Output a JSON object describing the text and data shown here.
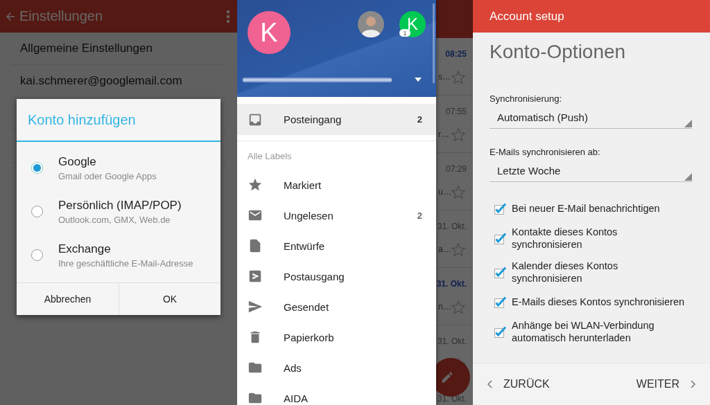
{
  "settings_screen": {
    "title": "Einstellungen",
    "items": [
      "Allgemeine Einstellungen",
      "kai.schmerer@googlemail.com"
    ]
  },
  "add_account_dialog": {
    "title": "Konto hinzufügen",
    "options": [
      {
        "label": "Google",
        "description": "Gmail oder Google Apps",
        "selected": true
      },
      {
        "label": "Persönlich (IMAP/POP)",
        "description": "Outlook.com, GMX, Web.de",
        "selected": false
      },
      {
        "label": "Exchange",
        "description": "Ihre geschäftliche E-Mail-Adresse",
        "selected": false
      }
    ],
    "buttons": [
      "Abbrechen",
      "OK"
    ]
  },
  "mail_list": {
    "rows": [
      {
        "time": "08:25",
        "snippet": "s…",
        "unread": true
      },
      {
        "time": "07:55",
        "snippet": "r…",
        "unread": false
      },
      {
        "time": "07:29",
        "snippet": "u…",
        "unread": false
      },
      {
        "time": "31. Okt.",
        "snippet": "a…",
        "unread": false
      },
      {
        "time": "31. Okt.",
        "snippet": "n…",
        "unread": true
      },
      {
        "time": "31. Okt.",
        "unread": false
      },
      {
        "time": "31. Okt.",
        "unread": false
      }
    ]
  },
  "drawer": {
    "account_initial": "K",
    "other_account_initial": "K",
    "other_account_badge": "1",
    "primary": [
      {
        "kind": "inbox",
        "label": "Posteingang",
        "count": "2",
        "selected": true
      }
    ],
    "section_title": "Alle Labels",
    "labels": [
      {
        "kind": "star",
        "label": "Markiert",
        "selected": false
      },
      {
        "kind": "mail",
        "label": "Ungelesen",
        "count": "2",
        "selected": false
      },
      {
        "kind": "draft",
        "label": "Entwürfe",
        "selected": false
      },
      {
        "kind": "outbox",
        "label": "Postausgang",
        "selected": false
      },
      {
        "kind": "send",
        "label": "Gesendet",
        "selected": false
      },
      {
        "kind": "trash",
        "label": "Papierkorb",
        "selected": false
      },
      {
        "kind": "folder",
        "label": "Ads",
        "selected": false
      },
      {
        "kind": "folder",
        "label": "AIDA",
        "selected": false
      }
    ]
  },
  "account_setup": {
    "title": "Account setup",
    "heading": "Konto-Optionen",
    "fields": [
      {
        "label": "Synchronisierung:",
        "value": "Automatisch (Push)"
      },
      {
        "label": "E-Mails synchronisieren ab:",
        "value": "Letzte Woche"
      }
    ],
    "checkboxes": [
      {
        "label": "Bei neuer E-Mail benachrichtigen",
        "checked": true
      },
      {
        "label": "Kontakte dieses Kontos synchronisieren",
        "checked": true
      },
      {
        "label": "Kalender dieses Kontos synchronisieren",
        "checked": true
      },
      {
        "label": "E-Mails dieses Kontos synchronisieren",
        "checked": true
      },
      {
        "label": "Anhänge bei WLAN-Verbindung automatisch herunterladen",
        "checked": true
      }
    ],
    "back_button": "ZURÜCK",
    "next_button": "WEITER"
  }
}
